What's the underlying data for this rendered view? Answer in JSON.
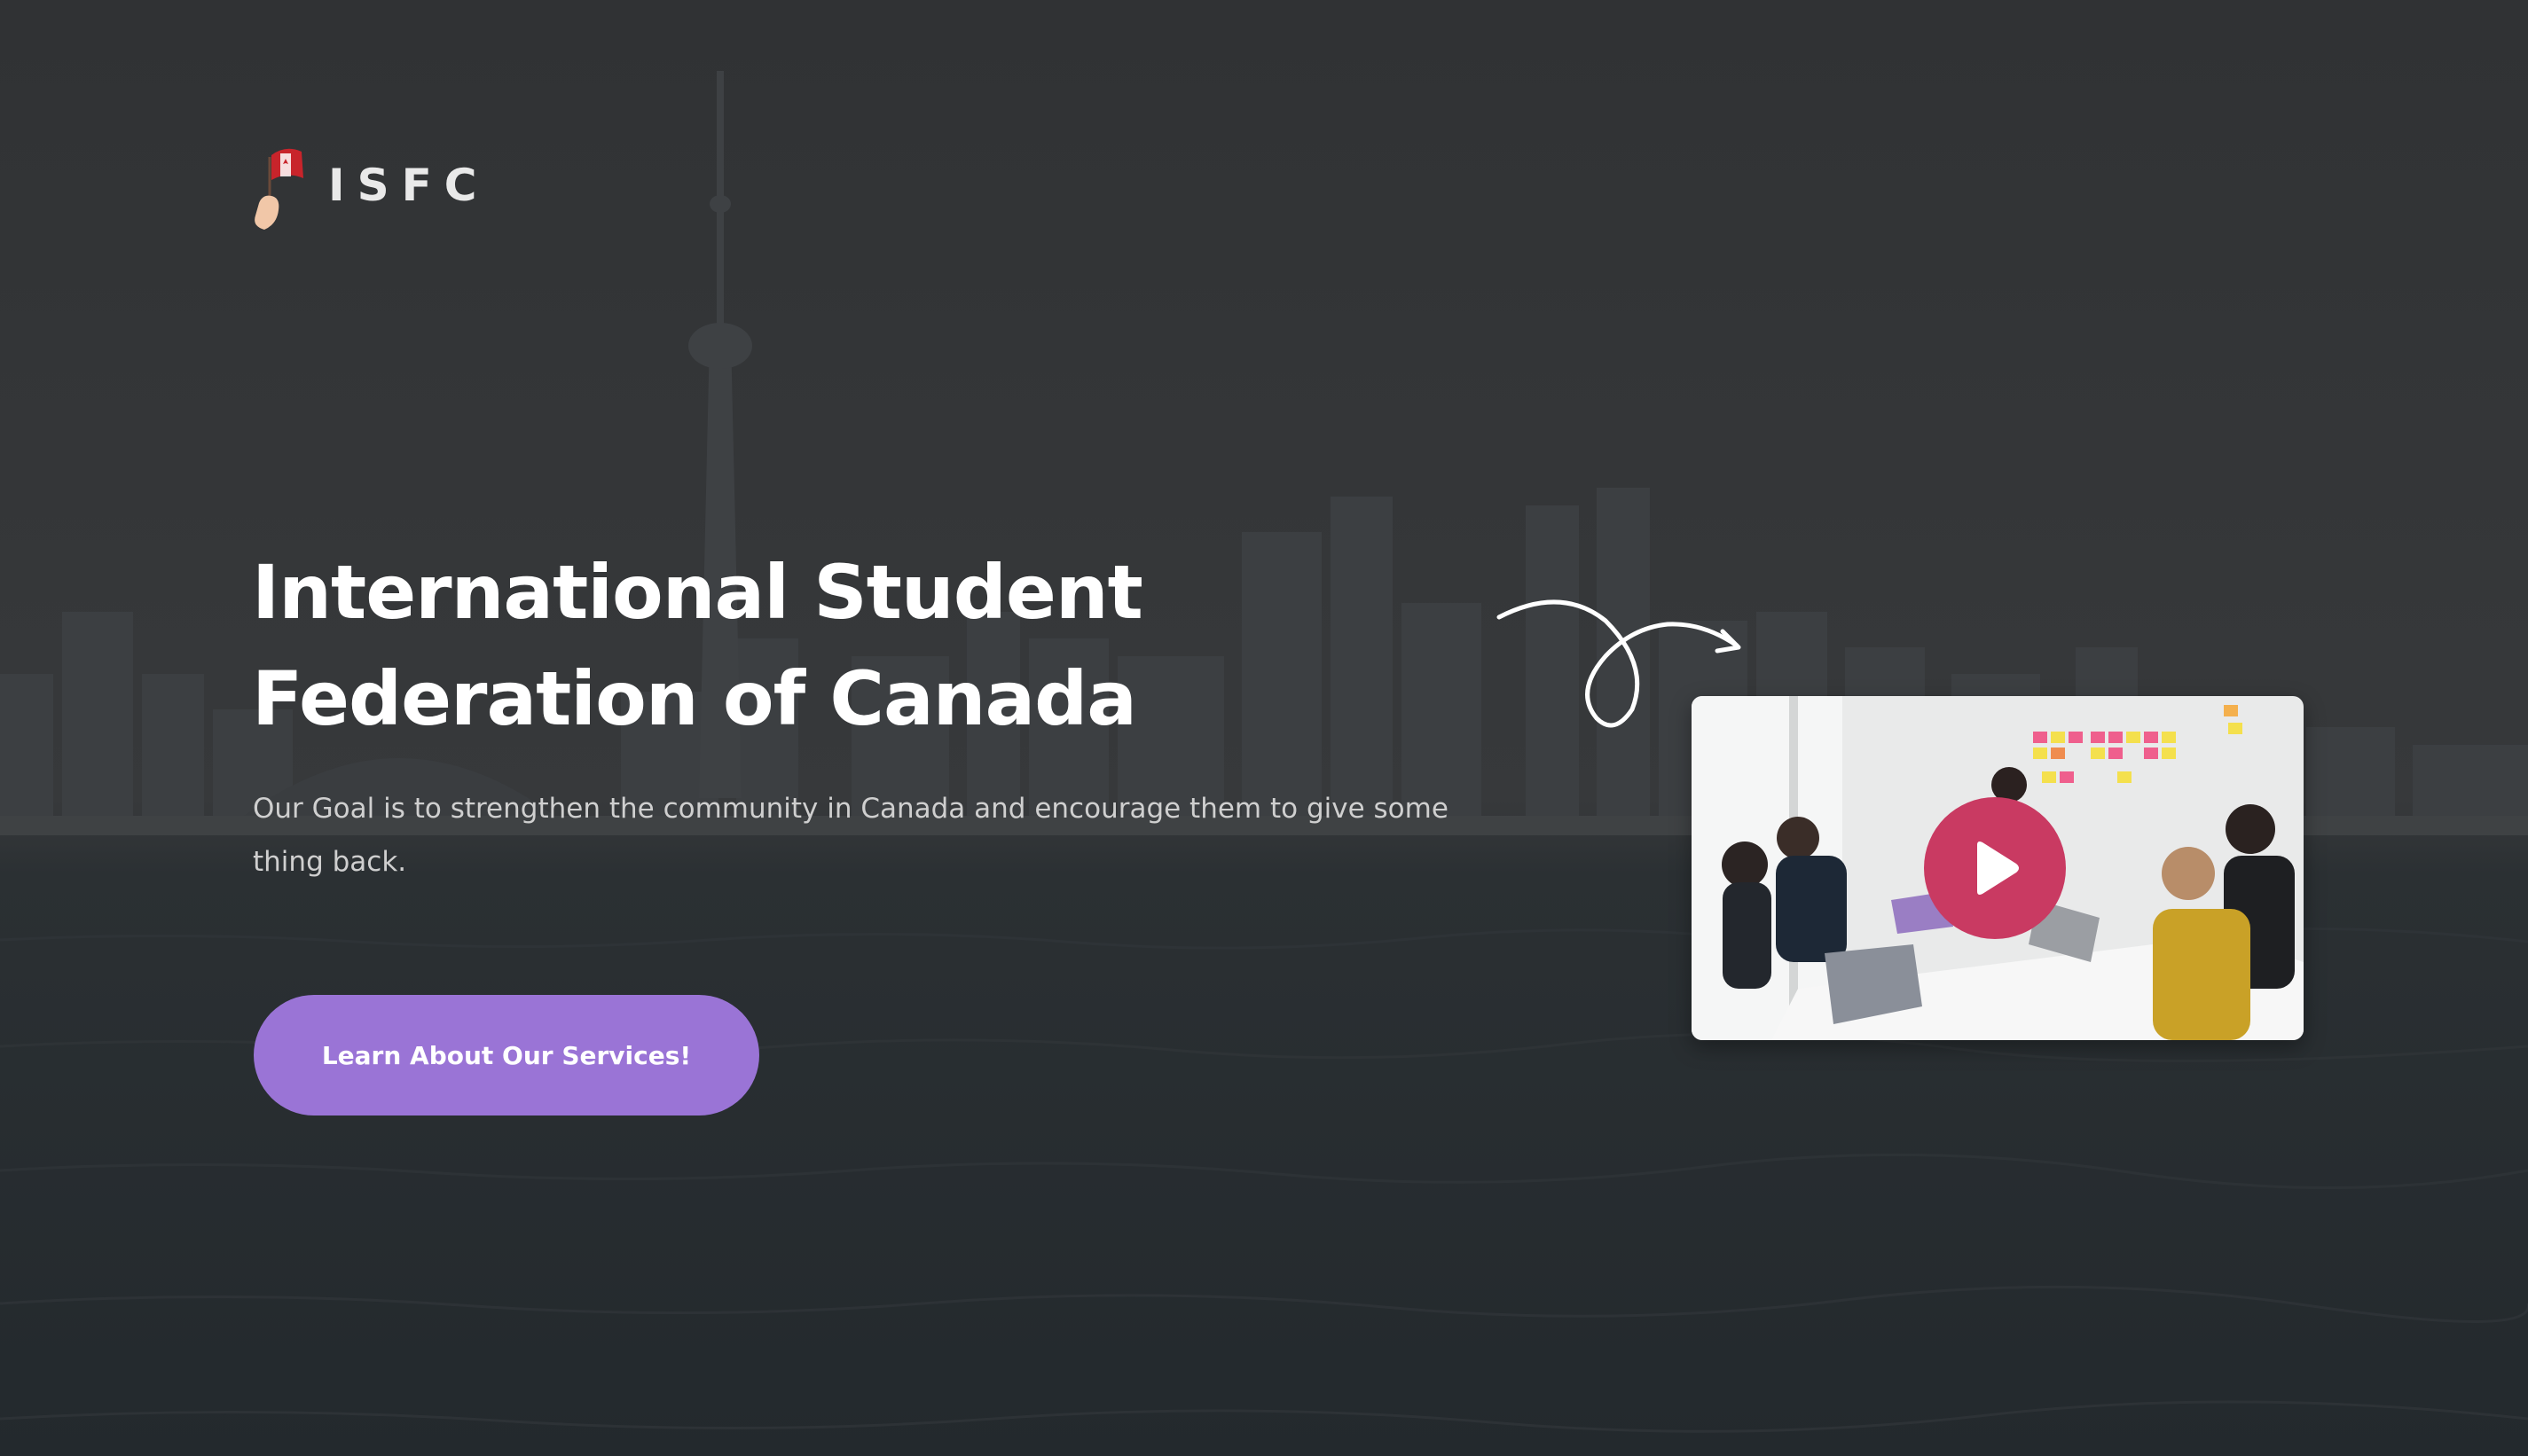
{
  "brand": {
    "name": "ISFC",
    "logo_icon": "hand-holding-canada-flag-icon"
  },
  "hero": {
    "title": "International Student Federation of Canada",
    "subtitle": "Our Goal is to strengthen the community in Canada and encourage them to give some thing back.",
    "cta_label": "Learn About Our Services!",
    "background": "toronto-skyline-over-water-image"
  },
  "video": {
    "thumbnail": "team-meeting-with-sticky-notes-image",
    "play_icon": "play-icon",
    "decoration": "curly-arrow-icon"
  },
  "colors": {
    "overlay": "#2f3134",
    "cta": "#9a74d6",
    "play": "#c93a62",
    "title": "#ffffff",
    "subtitle": "#cfcfcf"
  }
}
